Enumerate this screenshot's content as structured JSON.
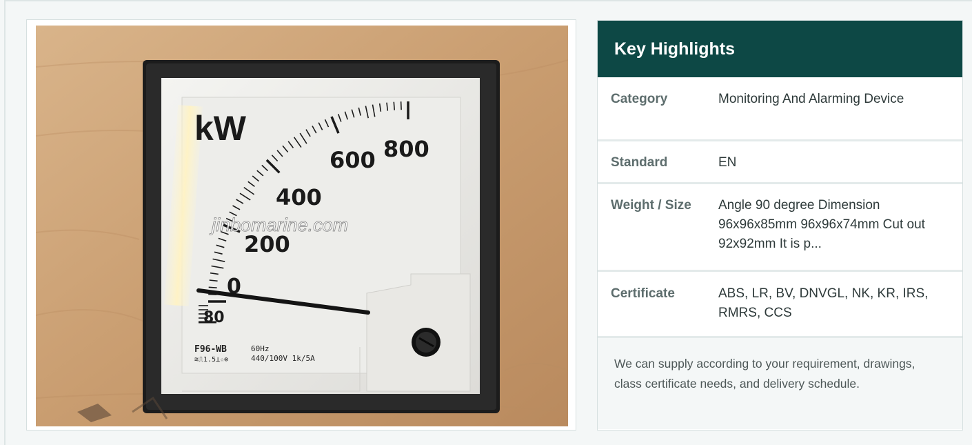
{
  "product_photo": {
    "alt": "Analog kW meter",
    "dial": {
      "unit": "kW",
      "scale_labels": [
        "80",
        "0",
        "200",
        "400",
        "600",
        "800"
      ],
      "model": "F96-WB",
      "frequency": "60Hz",
      "rating": "440/100V 1k/5A",
      "symbols": "≋⎍1.5⊥☆⊗",
      "watermark": "jinbomarine.com"
    }
  },
  "highlights": {
    "title": "Key Highlights",
    "rows": [
      {
        "key": "Category",
        "value": "Monitoring And Alarming Device"
      },
      {
        "key": "Standard",
        "value": "EN"
      },
      {
        "key": "Weight / Size",
        "value": "Angle 90 degree Dimension 96x96x85mm  96x96x74mm Cut out 92x92mm It is p..."
      },
      {
        "key": "Certificate",
        "value": "ABS, LR, BV, DNVGL, NK, KR, IRS, RMRS, CCS"
      }
    ],
    "note": "We can supply according to your requirement, drawings, class certificate needs, and delivery schedule."
  },
  "colors": {
    "header_bg": "#0d4845",
    "page_bg": "#f4f7f7"
  }
}
